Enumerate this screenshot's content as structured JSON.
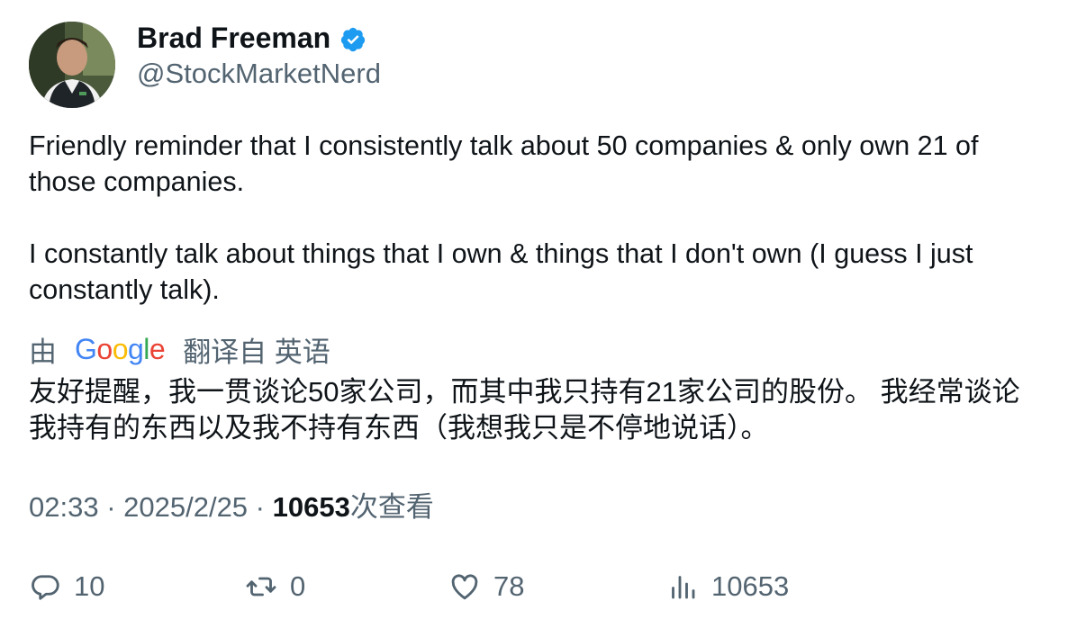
{
  "author": {
    "name": "Brad Freeman",
    "handle": "@StockMarketNerd",
    "verified": true,
    "verified_color": "#1d9bf0"
  },
  "tweet": {
    "paragraph1": "Friendly reminder that I consistently talk about 50 companies & only own 21 of those companies.",
    "paragraph2": "I constantly talk about things that I own & things that I don't own (I guess I just constantly talk)."
  },
  "translation": {
    "prefix": "由",
    "provider": "Google",
    "suffix": "翻译自 英语",
    "text": "友好提醒，我一贯谈论50家公司，而其中我只持有21家公司的股份。 我经常谈论我持有的东西以及我不持有东西（我想我只是不停地说话）。"
  },
  "meta": {
    "time": "02:33",
    "separator": " · ",
    "date": "2025/2/25",
    "views_count": "10653",
    "views_label": "次查看"
  },
  "actions": {
    "reply": {
      "icon": "reply-icon",
      "count": "10"
    },
    "retweet": {
      "icon": "retweet-icon",
      "count": "0"
    },
    "like": {
      "icon": "heart-icon",
      "count": "78"
    },
    "views": {
      "icon": "analytics-icon",
      "count": "10653"
    }
  },
  "colors": {
    "text_primary": "#0f1419",
    "text_secondary": "#536471",
    "google_blue": "#4285F4",
    "google_red": "#EA4335",
    "google_yellow": "#FBBC05",
    "google_green": "#34A853"
  }
}
